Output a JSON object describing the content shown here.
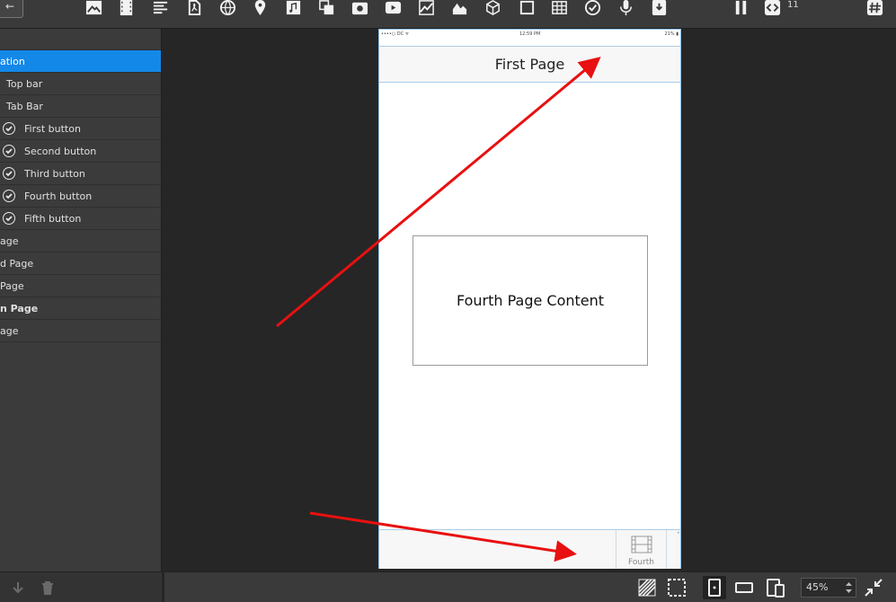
{
  "toolbar": {
    "back_label": "←",
    "icons": [
      "image-icon",
      "film-icon",
      "text-icon",
      "pdf-icon",
      "globe-icon",
      "location-pin-icon",
      "music-note-icon",
      "duplicate-icon",
      "camera-icon",
      "play-icon",
      "chart-icon",
      "area-chart-icon",
      "cube-icon",
      "rectangle-icon",
      "table-icon",
      "checkmark-circle-icon",
      "microphone-icon",
      "download-box-icon",
      "pause-icon",
      "code-icon",
      "hash-icon"
    ],
    "code_count": "11"
  },
  "sidebar": {
    "items": [
      {
        "label": "ation",
        "selected": true
      },
      {
        "label": "Top bar"
      },
      {
        "label": "Tab Bar"
      },
      {
        "label": "First button",
        "checked": true
      },
      {
        "label": "Second button",
        "checked": true
      },
      {
        "label": "Third button",
        "checked": true
      },
      {
        "label": "Fourth button",
        "checked": true
      },
      {
        "label": "Fifth button",
        "checked": true
      },
      {
        "label": "age"
      },
      {
        "label": "d Page"
      },
      {
        "label": "Page"
      },
      {
        "label": "n Page",
        "bold": true
      },
      {
        "label": "age"
      }
    ]
  },
  "phone": {
    "status_left": "••••○ DC ᯤ",
    "status_center": "12:59 PM",
    "status_right": "21% ▮",
    "nav_title": "First Page",
    "content_text": "Fourth Page Content",
    "tab_label": "Fourth",
    "tab_icon": "film-icon"
  },
  "bottombar": {
    "zoom_value": "45%"
  },
  "colors": {
    "selection": "#1388e8",
    "annotation_arrow": "#e81010"
  }
}
